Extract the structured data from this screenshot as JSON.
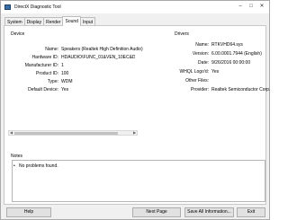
{
  "window": {
    "title": "DirectX Diagnostic Tool",
    "minimize": "–",
    "maximize": "□",
    "close": "✕"
  },
  "tabs": [
    "System",
    "Display",
    "Render",
    "Sound",
    "Input"
  ],
  "active_tab": "Sound",
  "device": {
    "heading": "Device",
    "rows": [
      {
        "label": "Name:",
        "value": "Speakers (Realtek High Definition Audio)"
      },
      {
        "label": "Hardware ID:",
        "value": "HDAUDIO\\FUNC_01&VEN_10EC&DEV_0282&SUBSYS_103"
      },
      {
        "label": "Manufacturer ID:",
        "value": "1"
      },
      {
        "label": "Product ID:",
        "value": "100"
      },
      {
        "label": "Type:",
        "value": "WDM"
      },
      {
        "label": "Default Device:",
        "value": "Yes"
      }
    ]
  },
  "drivers": {
    "heading": "Drivers",
    "rows": [
      {
        "label": "Name:",
        "value": "RTKVHD64.sys"
      },
      {
        "label": "Version:",
        "value": "6.00.0001.7944 (English)"
      },
      {
        "label": "Date:",
        "value": "9/26/2016 00:00:00"
      },
      {
        "label": "WHQL Logo'd:",
        "value": "Yes"
      },
      {
        "label": "Other Files:",
        "value": ""
      },
      {
        "label": "Provider:",
        "value": "Realtek Semiconductor Corp."
      }
    ]
  },
  "notes": {
    "heading": "Notes",
    "items": [
      "No problems found."
    ]
  },
  "buttons": {
    "help": "Help",
    "next_page": "Next Page",
    "save_all": "Save All Information...",
    "exit": "Exit"
  }
}
